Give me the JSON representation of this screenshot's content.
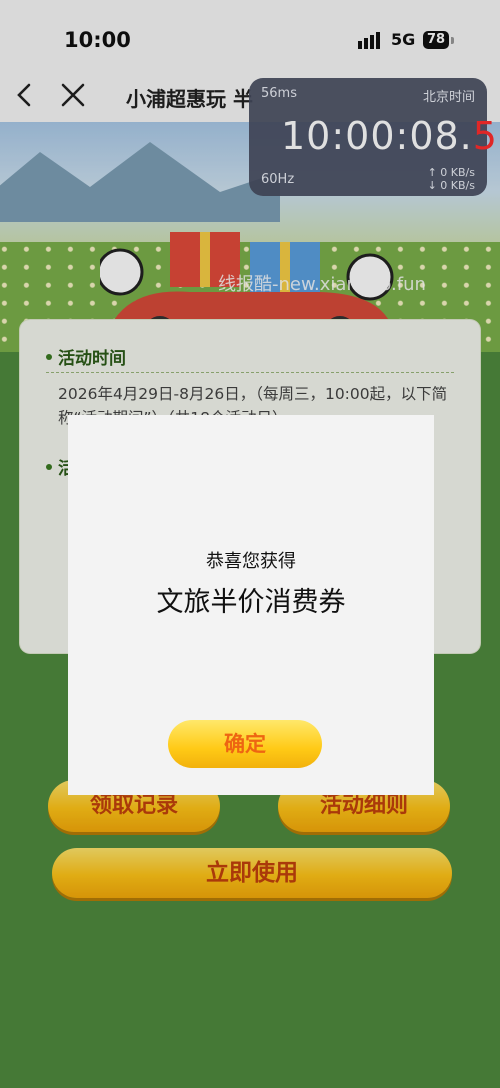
{
  "status_bar": {
    "time": "10:00",
    "network": "5G",
    "battery": "78"
  },
  "navbar": {
    "title": "小浦超惠玩 半"
  },
  "clock_overlay": {
    "latency": "56ms",
    "zone": "北京时间",
    "time_main": "10:00:08.",
    "time_last": "5",
    "refresh": "60Hz",
    "up": "↑ 0 KB/s",
    "down": "↓ 0 KB/s"
  },
  "banner": {
    "watermark": "线报酷-new.xianbao.fun"
  },
  "info": {
    "h1": "活动时间",
    "time_text": "2026年4月29日-8月26日，（每周三，10:00起，以下简称“活动期间”）（共18个活动日）",
    "h2": "活"
  },
  "buttons": {
    "record": "领取记录",
    "rules": "活动细则",
    "use": "立即使用"
  },
  "modal": {
    "subtitle": "恭喜您获得",
    "title": "文旅半价消费券",
    "confirm": "确定"
  },
  "colors": {
    "accent": "#ffc417",
    "button_text": "#c2410c",
    "page_bg": "#4f8a3e"
  }
}
